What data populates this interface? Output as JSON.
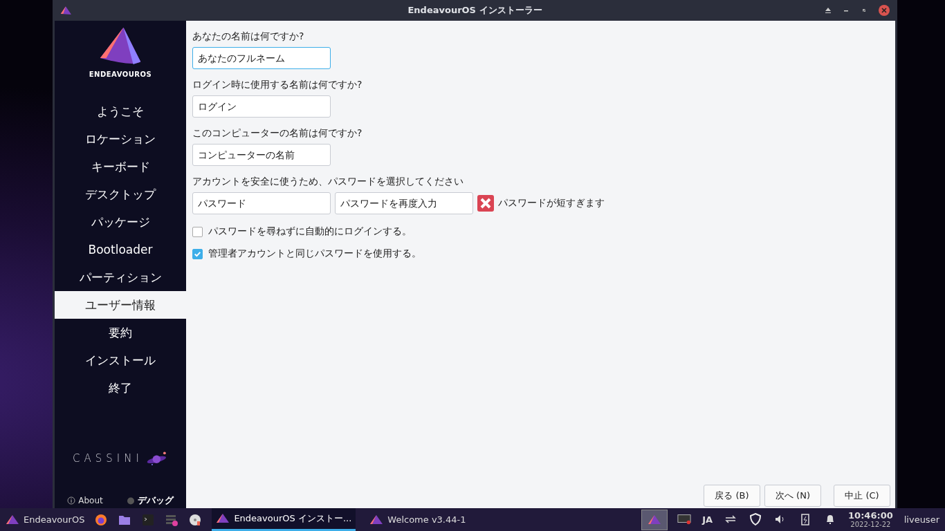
{
  "window": {
    "title": "EndeavourOS インストーラー"
  },
  "sidebar": {
    "logo_text": "ENDEAVOUROS",
    "items": [
      {
        "label": "ようこそ",
        "selected": false
      },
      {
        "label": "ロケーション",
        "selected": false
      },
      {
        "label": "キーボード",
        "selected": false
      },
      {
        "label": "デスクトップ",
        "selected": false
      },
      {
        "label": "パッケージ",
        "selected": false
      },
      {
        "label": "Bootloader",
        "selected": false
      },
      {
        "label": "パーティション",
        "selected": false
      },
      {
        "label": "ユーザー情報",
        "selected": true
      },
      {
        "label": "要約",
        "selected": false
      },
      {
        "label": "インストール",
        "selected": false
      },
      {
        "label": "終了",
        "selected": false
      }
    ],
    "release_name": "CASSINI",
    "about": "About",
    "debug": "デバッグ"
  },
  "form": {
    "full_name": {
      "label": "あなたの名前は何ですか?",
      "placeholder": "あなたのフルネーム"
    },
    "login": {
      "label": "ログイン時に使用する名前は何ですか?",
      "placeholder": "ログイン"
    },
    "hostname": {
      "label": "このコンピューターの名前は何ですか?",
      "placeholder": "コンピューターの名前"
    },
    "password": {
      "label": "アカウントを安全に使うため、パスワードを選択してください",
      "placeholder": "パスワード",
      "repeat_placeholder": "パスワードを再度入力",
      "error": "パスワードが短すぎます"
    },
    "options": [
      {
        "label": "パスワードを尋ねずに自動的にログインする。",
        "checked": false
      },
      {
        "label": "管理者アカウントと同じパスワードを使用する。",
        "checked": true
      }
    ]
  },
  "buttons": [
    "戻る (B)",
    "次へ (N)",
    "中止 (C)"
  ],
  "taskbar": {
    "start": "EndeavourOS",
    "tasks": [
      {
        "label": "EndeavourOS インストー...",
        "selected": true
      },
      {
        "label": "Welcome v3.44-1",
        "selected": false
      }
    ],
    "keyboard_layout": "JA",
    "time": "10:46:00",
    "date": "2022-12-22",
    "user": "liveuser"
  }
}
